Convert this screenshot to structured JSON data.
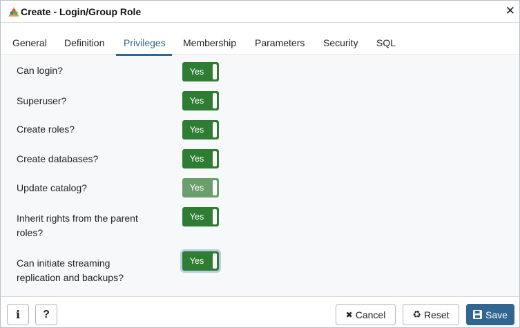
{
  "dialog": {
    "title": "Create - Login/Group Role",
    "close_glyph": "✕",
    "icon": "group-role-icon"
  },
  "tabs": [
    {
      "label": "General"
    },
    {
      "label": "Definition"
    },
    {
      "label": "Privileges",
      "active": true
    },
    {
      "label": "Membership"
    },
    {
      "label": "Parameters"
    },
    {
      "label": "Security"
    },
    {
      "label": "SQL"
    }
  ],
  "fields": [
    {
      "label": "Can login?",
      "value": "Yes"
    },
    {
      "label": "Superuser?",
      "value": "Yes"
    },
    {
      "label": "Create roles?",
      "value": "Yes"
    },
    {
      "label": "Create databases?",
      "value": "Yes"
    },
    {
      "label": "Update catalog?",
      "value": "Yes",
      "disabled": true
    },
    {
      "label_line1": "Inherit rights from the parent",
      "label_line2": "roles?",
      "value": "Yes"
    },
    {
      "label_line1": "Can initiate streaming",
      "label_line2": "replication and backups?",
      "value": "Yes",
      "focused": true
    }
  ],
  "footer": {
    "info_glyph": "i",
    "help_glyph": "?",
    "cancel_label": "Cancel",
    "cancel_glyph": "✖",
    "reset_label": "Reset",
    "reset_glyph": "♻",
    "save_label": "Save",
    "save_glyph": "💾"
  },
  "colors": {
    "accent": "#326690",
    "switch_on": "#2e7d32",
    "switch_disabled": "#6b9e6d"
  }
}
